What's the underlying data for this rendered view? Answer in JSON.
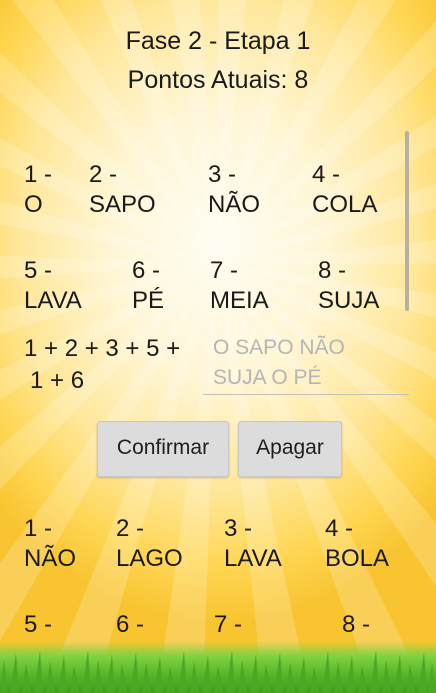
{
  "header": {
    "title": "Fase 2 - Etapa 1",
    "points": "Pontos Atuais: 8"
  },
  "words_top": [
    {
      "num": "1 -",
      "word": "O"
    },
    {
      "num": "2 -",
      "word": "SAPO"
    },
    {
      "num": "3 -",
      "word": "NÃO"
    },
    {
      "num": "4 -",
      "word": "COLA"
    },
    {
      "num": "5 -",
      "word": "LAVA"
    },
    {
      "num": "6 -",
      "word": "PÉ"
    },
    {
      "num": "7 -",
      "word": "MEIA"
    },
    {
      "num": "8 -",
      "word": "SUJA"
    }
  ],
  "sum": {
    "line1": "1 + 2 + 3 + 5 +",
    "line2": "1 + 6"
  },
  "answer": {
    "placeholder_line1": "O SAPO NÃO",
    "placeholder_line2": "SUJA O PÉ"
  },
  "buttons": {
    "confirm": "Confirmar",
    "erase": "Apagar"
  },
  "words_bottom": [
    {
      "num": "1 -",
      "word": "NÃO"
    },
    {
      "num": "2 -",
      "word": "LAGO"
    },
    {
      "num": "3 -",
      "word": "LAVA"
    },
    {
      "num": "4 -",
      "word": "BOLA"
    },
    {
      "num": "5 -",
      "word": ""
    },
    {
      "num": "6 -",
      "word": ""
    },
    {
      "num": "7 -",
      "word": ""
    },
    {
      "num": "8 -",
      "word": ""
    }
  ]
}
